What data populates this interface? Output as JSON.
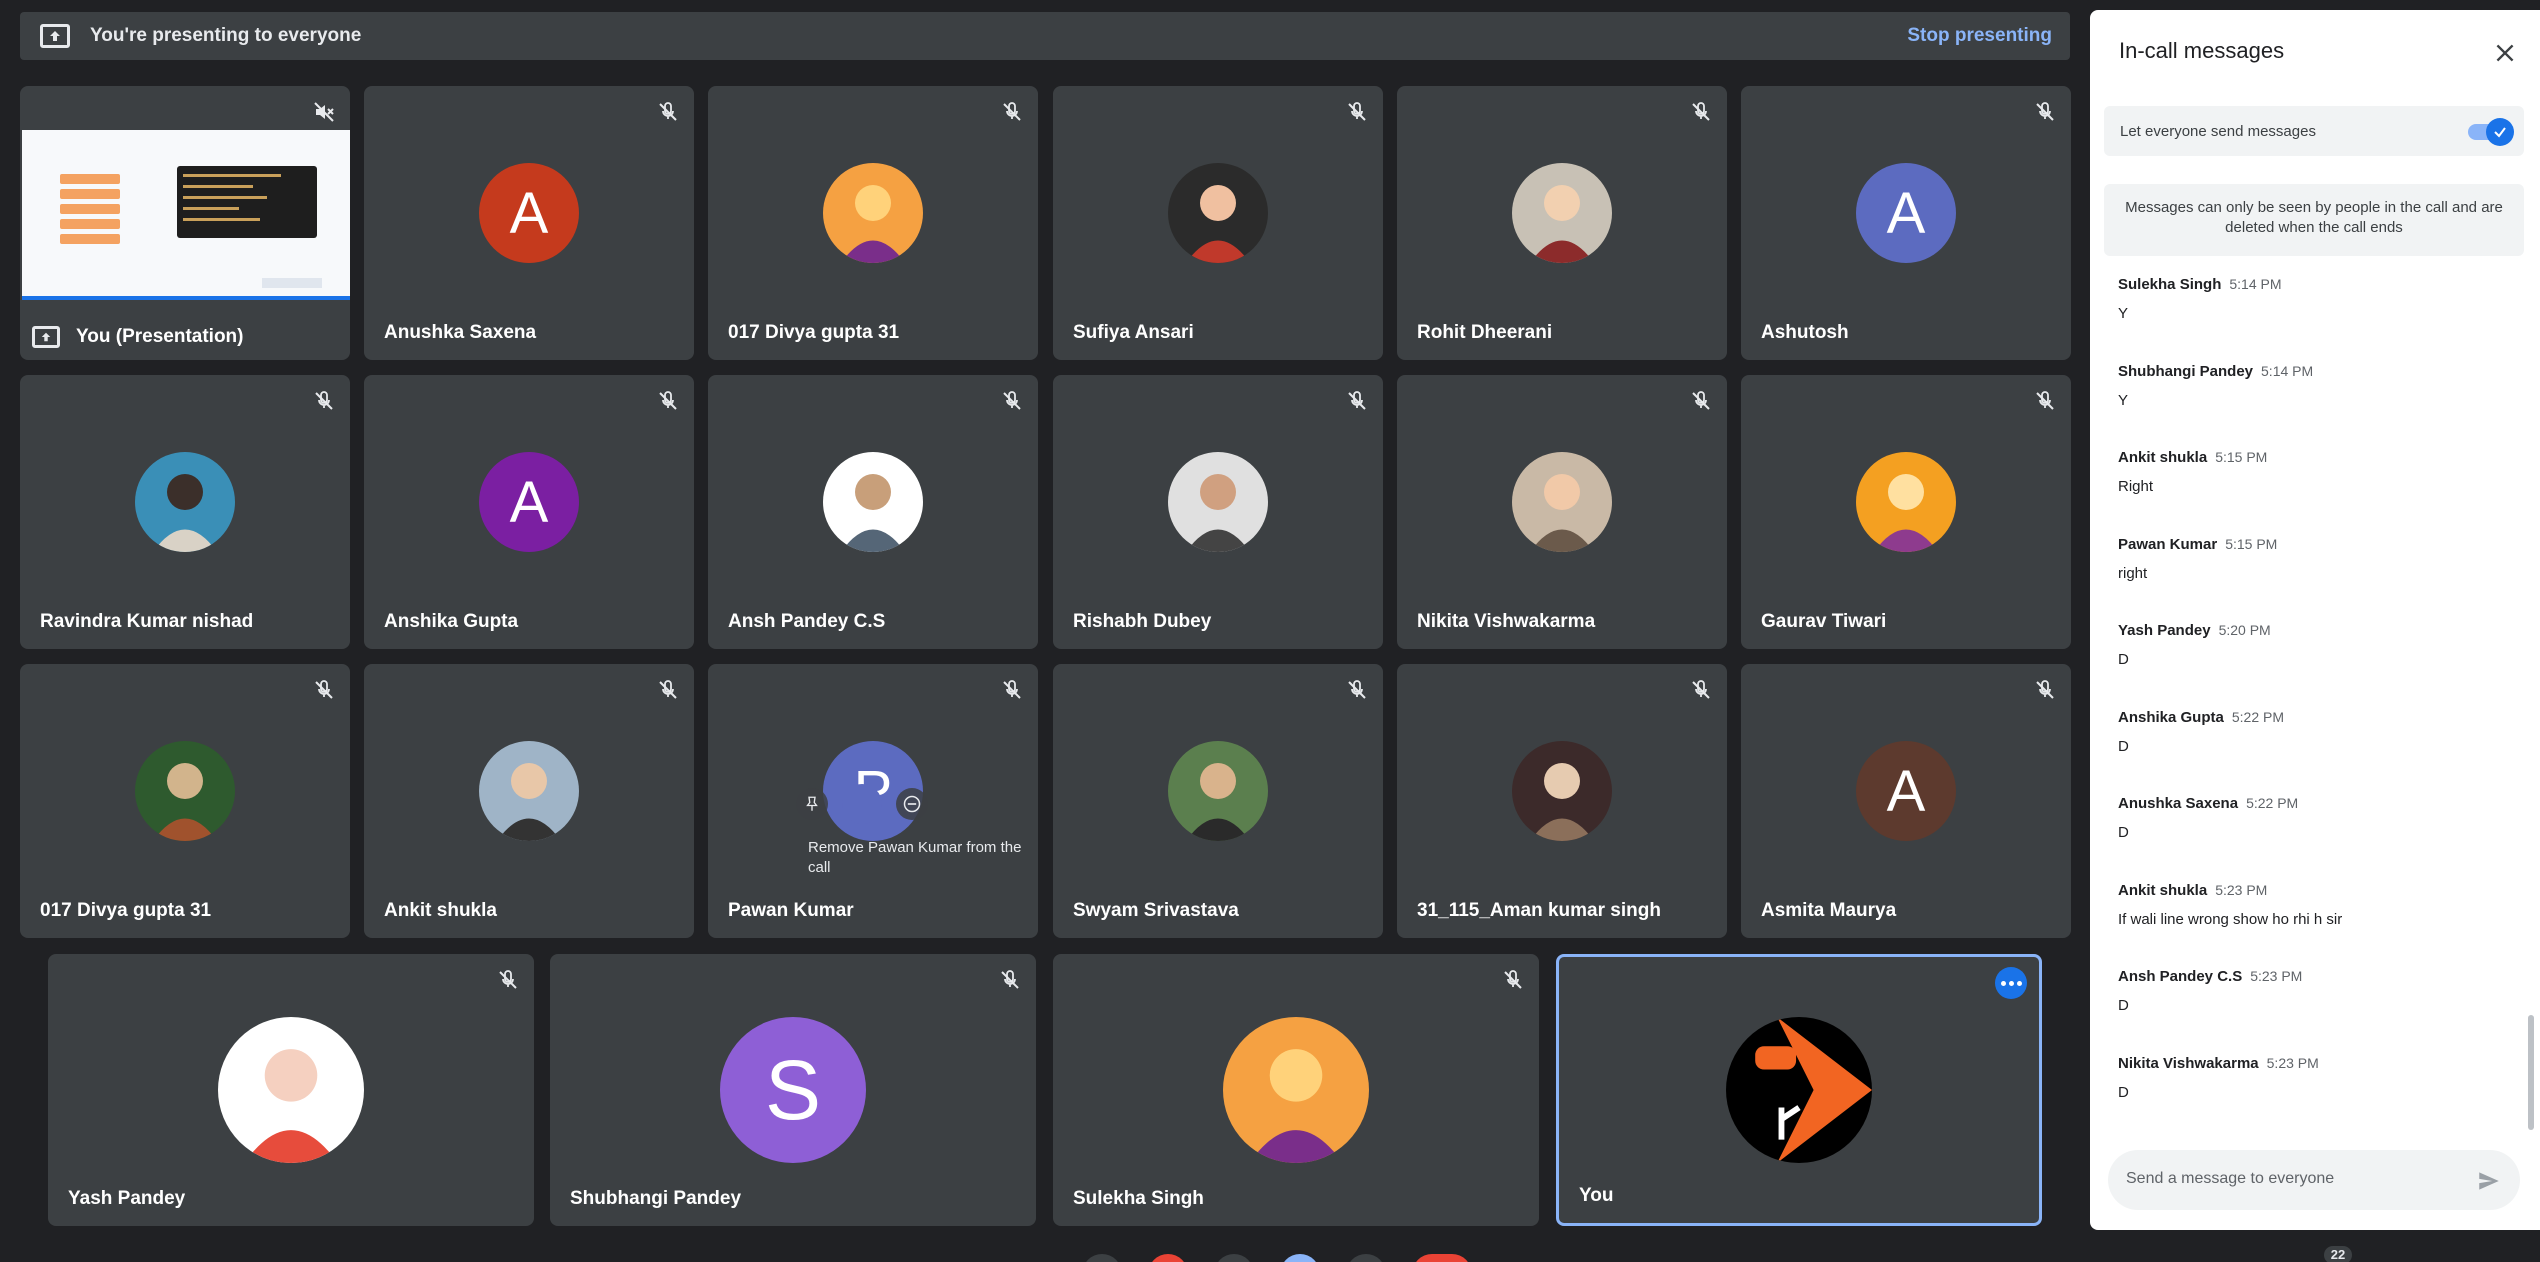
{
  "banner": {
    "text": "You're presenting to everyone",
    "stop_label": "Stop presenting",
    "icon": "present-to-all-icon"
  },
  "tiles": [
    {
      "name": "You (Presentation)",
      "kind": "presentation",
      "audio": "volume-off-icon"
    },
    {
      "name": "Anushka Saxena",
      "avatar_letter": "A",
      "avatar_color": "#c53a1d",
      "audio": "mic-off-icon"
    },
    {
      "name": "017 Divya gupta 31",
      "avatar": "photo",
      "audio": "mic-off-icon"
    },
    {
      "name": "Sufiya Ansari",
      "avatar": "photo",
      "audio": "mic-off-icon"
    },
    {
      "name": "Rohit Dheerani",
      "avatar": "photo",
      "audio": "mic-off-icon"
    },
    {
      "name": "Ashutosh",
      "avatar_letter": "A",
      "avatar_color": "#5c6bc0",
      "audio": "mic-off-icon"
    },
    {
      "name": "Ravindra Kumar nishad",
      "avatar": "photo",
      "audio": "mic-off-icon"
    },
    {
      "name": "Anshika Gupta",
      "avatar_letter": "A",
      "avatar_color": "#7b1fa2",
      "audio": "mic-off-icon"
    },
    {
      "name": "Ansh Pandey C.S",
      "avatar": "photo",
      "audio": "mic-off-icon"
    },
    {
      "name": "Rishabh Dubey",
      "avatar": "photo",
      "audio": "mic-off-icon"
    },
    {
      "name": "Nikita Vishwakarma",
      "avatar": "photo",
      "audio": "mic-off-icon"
    },
    {
      "name": "Gaurav Tiwari",
      "avatar": "photo",
      "audio": "mic-off-icon"
    },
    {
      "name": "017 Divya gupta 31",
      "avatar": "photo",
      "audio": "mic-off-icon"
    },
    {
      "name": "Ankit shukla",
      "avatar": "photo",
      "audio": "mic-off-icon"
    },
    {
      "name": "Pawan Kumar",
      "avatar_letter": "P",
      "avatar_color": "#5c6bc0",
      "audio": "mic-off-icon"
    },
    {
      "name": "Swyam Srivastava",
      "avatar": "photo",
      "audio": "mic-off-icon"
    },
    {
      "name": "31_115_Aman kumar singh",
      "avatar": "photo",
      "audio": "mic-off-icon"
    },
    {
      "name": "Asmita Maurya",
      "avatar_letter": "A",
      "avatar_color": "#5d3a2e",
      "audio": "mic-off-icon"
    },
    {
      "name": "Yash Pandey",
      "avatar": "photo",
      "audio": "mic-off-icon"
    },
    {
      "name": "Shubhangi Pandey",
      "avatar_letter": "S",
      "avatar_color": "#8e5fd6",
      "audio": "mic-off-icon"
    },
    {
      "name": "Sulekha Singh",
      "avatar": "photo",
      "audio": "mic-off-icon"
    },
    {
      "name": "You",
      "avatar": "logo",
      "audio": "more-options-icon"
    }
  ],
  "hover": {
    "tooltip": "Remove Pawan Kumar from the call",
    "icons": [
      "pin-icon",
      "remove-icon"
    ]
  },
  "chat": {
    "title": "In-call messages",
    "toggle_label": "Let everyone send messages",
    "toggle_on": true,
    "notice": "Messages can only be seen by people in the call and are deleted when the call ends",
    "messages": [
      {
        "sender": "Sulekha Singh",
        "time": "5:14 PM",
        "text": "Y"
      },
      {
        "sender": "Shubhangi Pandey",
        "time": "5:14 PM",
        "text": "Y"
      },
      {
        "sender": "Ankit shukla",
        "time": "5:15 PM",
        "text": "Right"
      },
      {
        "sender": "Pawan Kumar",
        "time": "5:15 PM",
        "text": "right"
      },
      {
        "sender": "Yash Pandey",
        "time": "5:20 PM",
        "text": "D"
      },
      {
        "sender": "Anshika Gupta",
        "time": "5:22 PM",
        "text": "D"
      },
      {
        "sender": "Anushka Saxena",
        "time": "5:22 PM",
        "text": "D"
      },
      {
        "sender": "Ankit shukla",
        "time": "5:23 PM",
        "text": "If wali line wrong show ho rhi h sir"
      },
      {
        "sender": "Ansh Pandey C.S",
        "time": "5:23 PM",
        "text": "D"
      },
      {
        "sender": "Nikita Vishwakarma",
        "time": "5:23 PM",
        "text": "D"
      }
    ],
    "input_placeholder": "Send a message to everyone"
  },
  "participants_count": "22",
  "colors": {
    "background": "#202124",
    "tile": "#3c4043",
    "accent": "#8ab4f8",
    "primary": "#1a73e8"
  }
}
